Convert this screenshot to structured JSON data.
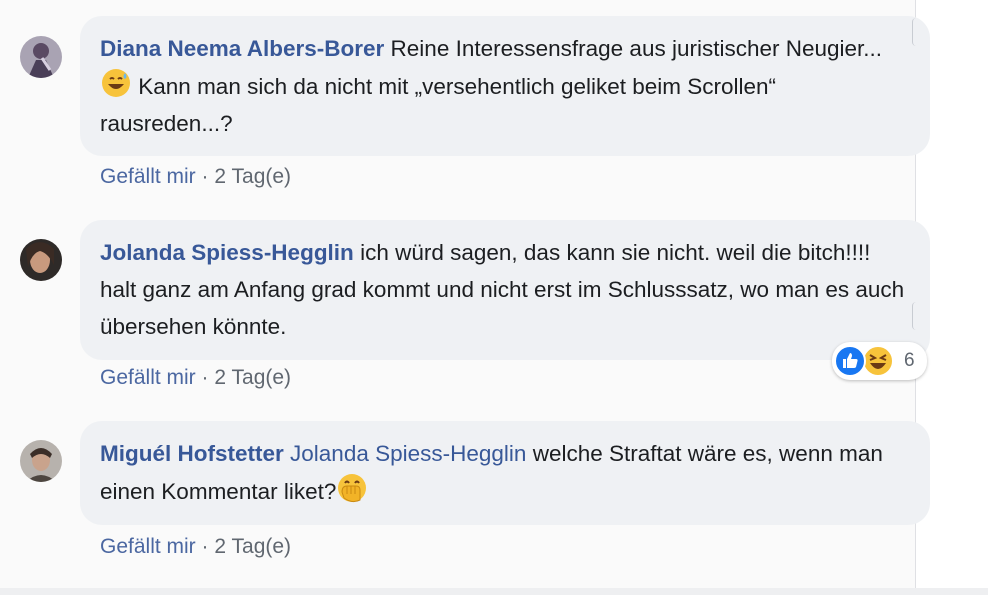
{
  "comments": [
    {
      "author": "Diana Neema Albers-Borer",
      "text_parts": [
        "Reine Interessensfrage aus juristischer Neugier...",
        "Kann man sich da nicht mit „versehentlich geliket beim Scrollen“ rausreden...?"
      ],
      "emoji": "sweat-smile-emoji",
      "like_label": "Gefällt mir",
      "separator": "·",
      "time": "2 Tag(e)"
    },
    {
      "author": "Jolanda Spiess-Hegglin",
      "text": "ich würd sagen, das kann sie nicht. weil die bitch!!!! halt ganz am Anfang grad kommt und nicht erst im Schlusssatz, wo man es auch übersehen könnte.",
      "like_label": "Gefällt mir",
      "separator": "·",
      "time": "2 Tag(e)",
      "reactions": {
        "icons": [
          "like-reaction-icon",
          "haha-reaction-icon"
        ],
        "count": "6"
      }
    },
    {
      "author": "Miguél Hofstetter",
      "mention": "Jolanda Spiess-Hegglin",
      "text": "welche Straftat wäre es, wenn man einen Kommentar liket?",
      "emoji": "hand-over-mouth-emoji",
      "like_label": "Gefällt mir",
      "separator": "·",
      "time": "2 Tag(e)"
    }
  ],
  "colors": {
    "author": "#385898",
    "bubble": "#eff1f4",
    "meta": "#606770",
    "like_blue": "#1877f2"
  }
}
